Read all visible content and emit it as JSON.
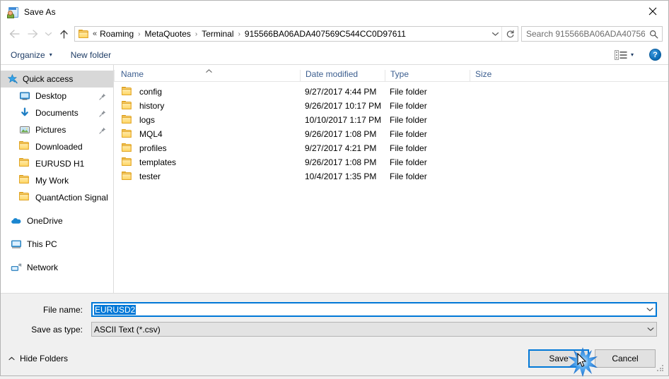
{
  "window": {
    "title": "Save As",
    "title_icon": "save-as-icon",
    "close_icon": "close-icon"
  },
  "nav": {
    "back_icon": "arrow-left-icon",
    "forward_icon": "arrow-right-icon",
    "recent_icon": "chevron-down-icon",
    "up_icon": "arrow-up-icon",
    "folder_icon": "folder-icon",
    "overflow": "«",
    "crumbs": [
      "Roaming",
      "MetaQuotes",
      "Terminal",
      "915566BA06ADA407569C544CC0D97611"
    ],
    "separator": "›",
    "dropdown_icon": "chevron-down-icon",
    "refresh_icon": "refresh-icon"
  },
  "search": {
    "placeholder": "Search 915566BA06ADA40756...",
    "icon": "search-icon"
  },
  "toolbar": {
    "organize": "Organize",
    "organize_caret": "▾",
    "new_folder": "New folder",
    "view_icon": "view-layout-icon",
    "view_caret": "▾",
    "help": "?"
  },
  "sidebar": {
    "items": [
      {
        "label": "Quick access",
        "icon": "star-pin-icon",
        "selected": true,
        "indent": 0,
        "pinned": false
      },
      {
        "label": "Desktop",
        "icon": "desktop-icon",
        "selected": false,
        "indent": 1,
        "pinned": true
      },
      {
        "label": "Documents",
        "icon": "documents-arrow-icon",
        "selected": false,
        "indent": 1,
        "pinned": true
      },
      {
        "label": "Pictures",
        "icon": "pictures-icon",
        "selected": false,
        "indent": 1,
        "pinned": true
      },
      {
        "label": "Downloaded",
        "icon": "folder-icon",
        "selected": false,
        "indent": 1,
        "pinned": false
      },
      {
        "label": "EURUSD H1",
        "icon": "folder-icon",
        "selected": false,
        "indent": 1,
        "pinned": false
      },
      {
        "label": "My Work",
        "icon": "folder-icon",
        "selected": false,
        "indent": 1,
        "pinned": false
      },
      {
        "label": "QuantAction Signal",
        "icon": "folder-icon",
        "selected": false,
        "indent": 1,
        "pinned": false
      },
      {
        "label": "OneDrive",
        "icon": "onedrive-cloud-icon",
        "selected": false,
        "indent": 0,
        "pinned": false,
        "gap_before": true
      },
      {
        "label": "This PC",
        "icon": "this-pc-icon",
        "selected": false,
        "indent": 0,
        "pinned": false,
        "gap_before": true
      },
      {
        "label": "Network",
        "icon": "network-icon",
        "selected": false,
        "indent": 0,
        "pinned": false,
        "gap_before": true
      }
    ]
  },
  "filelist": {
    "columns": [
      "Name",
      "Date modified",
      "Type",
      "Size"
    ],
    "sort_column": "Name",
    "sort_direction": "ascending",
    "rows": [
      {
        "name": "config",
        "date": "9/27/2017 4:44 PM",
        "type": "File folder",
        "size": ""
      },
      {
        "name": "history",
        "date": "9/26/2017 10:17 PM",
        "type": "File folder",
        "size": ""
      },
      {
        "name": "logs",
        "date": "10/10/2017 1:17 PM",
        "type": "File folder",
        "size": ""
      },
      {
        "name": "MQL4",
        "date": "9/26/2017 1:08 PM",
        "type": "File folder",
        "size": ""
      },
      {
        "name": "profiles",
        "date": "9/27/2017 4:21 PM",
        "type": "File folder",
        "size": ""
      },
      {
        "name": "templates",
        "date": "9/26/2017 1:08 PM",
        "type": "File folder",
        "size": ""
      },
      {
        "name": "tester",
        "date": "10/4/2017 1:35 PM",
        "type": "File folder",
        "size": ""
      }
    ]
  },
  "form": {
    "filename_label": "File name:",
    "filename_value": "EURUSD2",
    "filename_selected": true,
    "savetype_label": "Save as type:",
    "savetype_value": "ASCII Text (*.csv)",
    "dropdown_icon": "chevron-down-icon"
  },
  "footer": {
    "hide_folders": "Hide Folders",
    "hide_folders_caret": "⌃",
    "save": "Save",
    "cancel": "Cancel",
    "default_button": "Save"
  },
  "colors": {
    "accent": "#0078d7",
    "selection": "#0078d7",
    "column_header_text": "#3c5e8f",
    "command_link": "#1f3d66",
    "folder": "#ffd766",
    "sidebar_selected": "#d8d8d8"
  }
}
